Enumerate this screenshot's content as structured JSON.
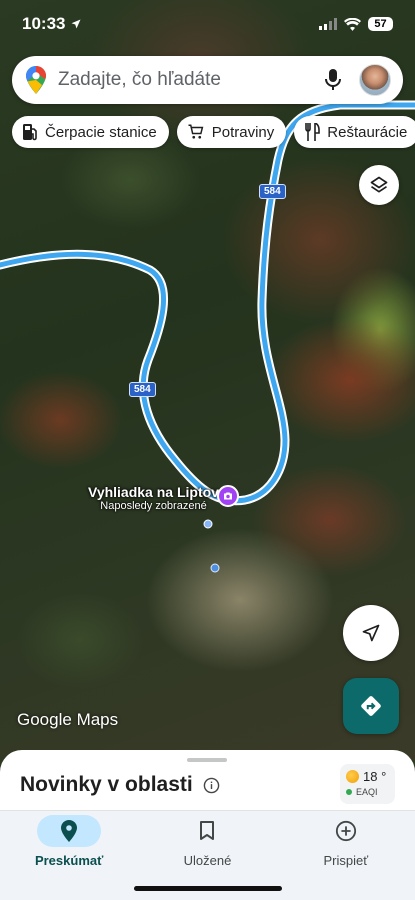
{
  "status_bar": {
    "time": "10:33",
    "battery": "57"
  },
  "search": {
    "placeholder": "Zadajte, čo hľadáte"
  },
  "chips": [
    {
      "label": "Čerpacie stanice",
      "icon": "gas-station-icon"
    },
    {
      "label": "Potraviny",
      "icon": "cart-icon"
    },
    {
      "label": "Reštaurácie",
      "icon": "fork-knife-icon"
    }
  ],
  "map": {
    "road_number": "584",
    "place": {
      "name": "Vyhliadka na Liptov",
      "subtitle": "Naposledy zobrazené",
      "icon": "camera-icon"
    },
    "logo": {
      "google": "Google",
      "maps": "Maps"
    },
    "colors": {
      "route": "#3fa7f0",
      "road_badge": "#2b62c7",
      "place_pin": "#a142f4"
    }
  },
  "sheet": {
    "title": "Novinky v oblasti",
    "weather": {
      "temperature": "18 °",
      "aqi_label": "EAQI"
    }
  },
  "nav": [
    {
      "label": "Preskúmať",
      "icon": "explore-pin-icon",
      "active": true
    },
    {
      "label": "Uložené",
      "icon": "bookmark-icon",
      "active": false
    },
    {
      "label": "Prispieť",
      "icon": "add-circle-icon",
      "active": false
    }
  ],
  "accent": "#0c6b6a"
}
